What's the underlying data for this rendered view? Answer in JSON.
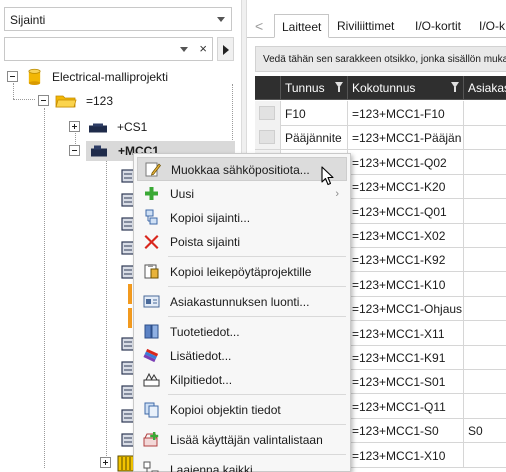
{
  "left_pane": {
    "location_combo": {
      "value": "Sijainti"
    },
    "filter_combo": {
      "value": "",
      "clear_glyph": "×"
    },
    "tree": {
      "nodes": [
        {
          "label": "Electrical-malliprojekti",
          "icon": "project-cylinder-icon"
        },
        {
          "label": "=123",
          "icon": "folder-open-icon"
        },
        {
          "label": "+CS1",
          "icon": "device-dark-icon"
        },
        {
          "label": "+MCC1",
          "icon": "device-dark-icon"
        },
        {
          "label": "",
          "icon": "cabinet-yellow-icon"
        }
      ]
    }
  },
  "right_pane": {
    "tabs": [
      "Laitteet",
      "Riviliittimet",
      "I/O-kortit",
      "I/O-k"
    ],
    "active_tab": "Laitteet",
    "group_hint": "Vedä tähän sen sarakkeen otsikko, jonka sisällön mukaan",
    "grid": {
      "columns": [
        "Tunnus",
        "Kokotunnus",
        "Asiakas"
      ],
      "rows": [
        {
          "tunnus": "F10",
          "kokotunnus": "=123+MCC1-F10",
          "asiakas": ""
        },
        {
          "tunnus": "Pääjännite",
          "kokotunnus": "=123+MCC1-Pääjän",
          "asiakas": ""
        },
        {
          "tunnus": "",
          "kokotunnus": "=123+MCC1-Q02",
          "asiakas": ""
        },
        {
          "tunnus": "",
          "kokotunnus": "=123+MCC1-K20",
          "asiakas": ""
        },
        {
          "tunnus": "",
          "kokotunnus": "=123+MCC1-Q01",
          "asiakas": ""
        },
        {
          "tunnus": "",
          "kokotunnus": "=123+MCC1-X02",
          "asiakas": ""
        },
        {
          "tunnus": "",
          "kokotunnus": "=123+MCC1-K92",
          "asiakas": ""
        },
        {
          "tunnus": "",
          "kokotunnus": "=123+MCC1-K10",
          "asiakas": ""
        },
        {
          "tunnus": "",
          "kokotunnus": "=123+MCC1-Ohjaus",
          "asiakas": ""
        },
        {
          "tunnus": "",
          "kokotunnus": "=123+MCC1-X11",
          "asiakas": ""
        },
        {
          "tunnus": "",
          "kokotunnus": "=123+MCC1-K91",
          "asiakas": ""
        },
        {
          "tunnus": "",
          "kokotunnus": "=123+MCC1-S01",
          "asiakas": ""
        },
        {
          "tunnus": "",
          "kokotunnus": "=123+MCC1-Q11",
          "asiakas": ""
        },
        {
          "tunnus": "",
          "kokotunnus": "=123+MCC1-S0",
          "asiakas": "S0"
        },
        {
          "tunnus": "",
          "kokotunnus": "=123+MCC1-X10",
          "asiakas": ""
        }
      ]
    }
  },
  "context_menu": {
    "items": [
      {
        "label": "Muokkaa sähköpositiota...",
        "icon": "edit-pencil-icon",
        "highlighted": true
      },
      {
        "label": "Uusi",
        "icon": "new-plus-icon",
        "submenu": true,
        "submenu_glyph": "›"
      },
      {
        "label": "Kopioi sijainti...",
        "icon": "copy-location-icon"
      },
      {
        "label": "Poista sijainti",
        "icon": "delete-x-icon"
      },
      {
        "label": "Kopioi leikepöytäprojektille",
        "icon": "clipboard-project-icon"
      },
      {
        "label": "Asiakastunnuksen luonti...",
        "icon": "customer-id-icon"
      },
      {
        "label": "Tuotetiedot...",
        "icon": "product-info-icon"
      },
      {
        "label": "Lisätiedot...",
        "icon": "additional-info-icon"
      },
      {
        "label": "Kilpitiedot...",
        "icon": "nameplate-icon"
      },
      {
        "label": "Kopioi objektin tiedot",
        "icon": "copy-object-icon"
      },
      {
        "label": "Lisää käyttäjän valintalistaan",
        "icon": "add-to-list-icon"
      },
      {
        "label": "Laajenna kaikki",
        "icon": "expand-all-icon"
      }
    ]
  },
  "colors": {
    "grid_header_bg": "#2f2f2f",
    "menu_bg": "#f7f7f7",
    "menu_highlight": "#dcdcdc",
    "delete_red": "#d9261c",
    "add_green": "#3aa935",
    "folder_yellow": "#f2b705"
  }
}
